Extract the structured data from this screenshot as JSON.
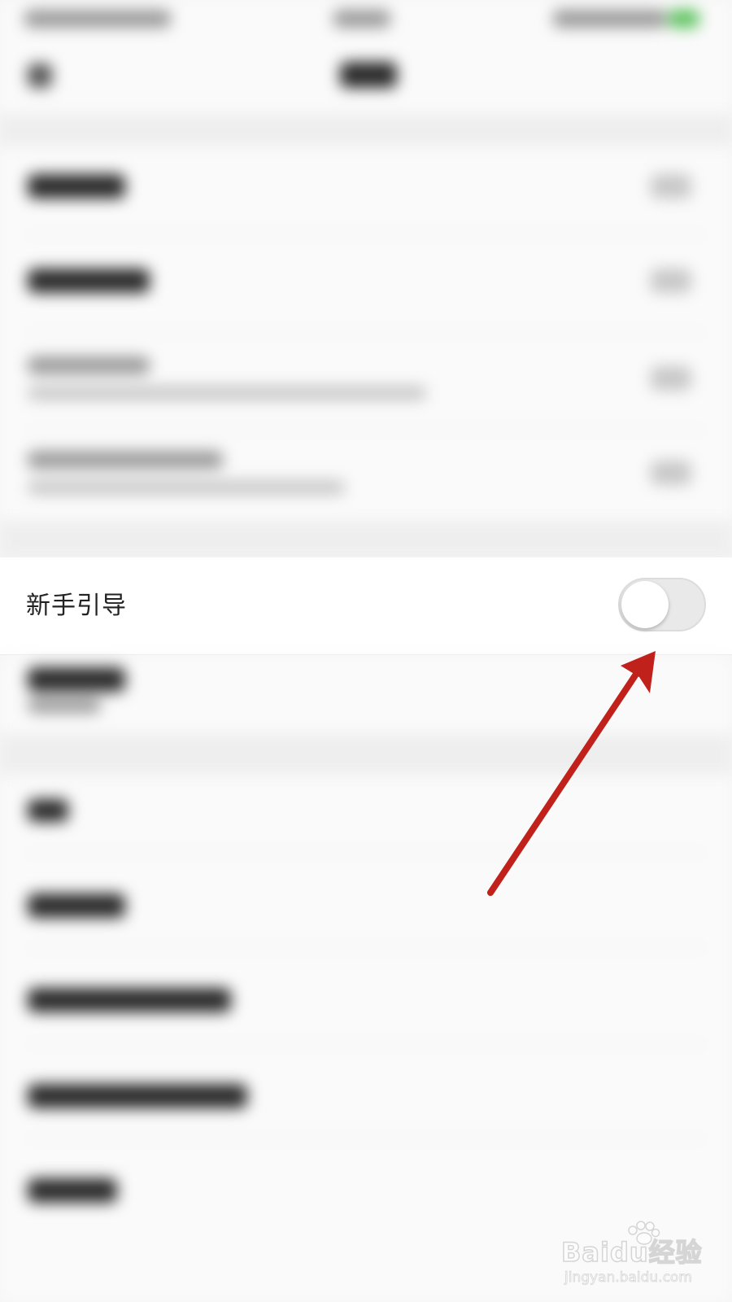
{
  "settings": {
    "focused_item": {
      "label": "新手引导",
      "toggle_on": false
    }
  },
  "colors": {
    "annotation_arrow": "#c0211a",
    "toggle_track_off": "#e9e9e9",
    "toggle_knob": "#ffffff",
    "status_battery": "#58c15a"
  },
  "icons": {
    "back": "back-arrow-icon",
    "watermark_paw": "baidu-paw-icon"
  },
  "watermark": {
    "logo_text": "Baidu经验",
    "url": "jingyan.baidu.com"
  }
}
